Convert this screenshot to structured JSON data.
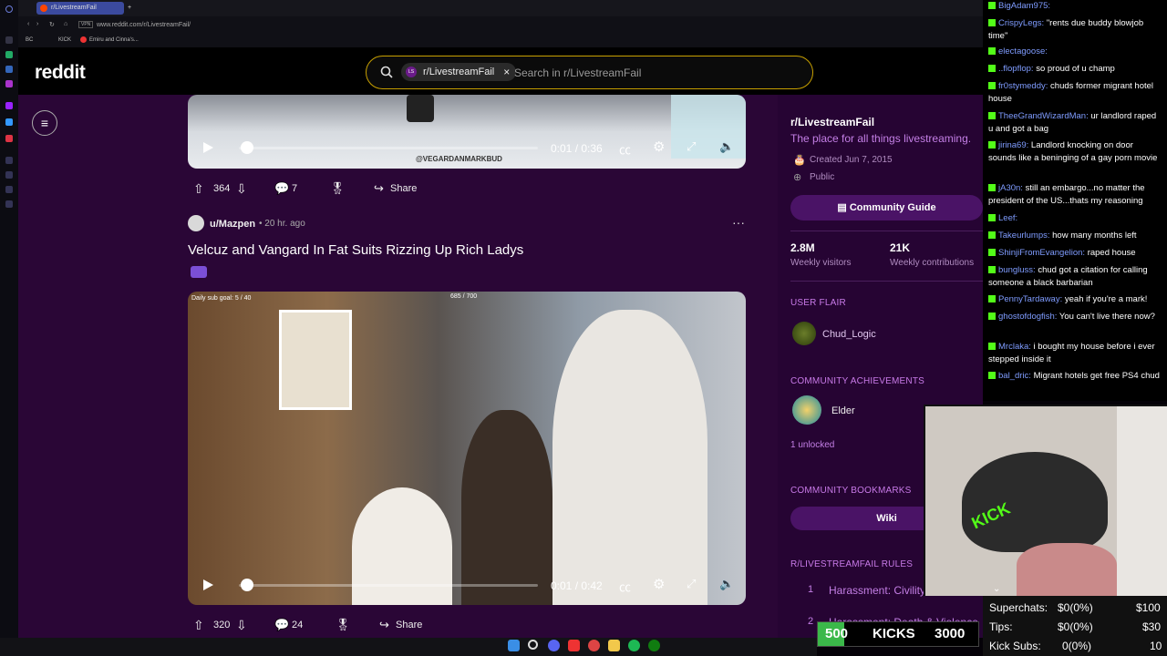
{
  "browser": {
    "tabs": [
      "r/LivestreamFail"
    ],
    "url": "www.reddit.com/r/LivestreamFail/",
    "vpn_label": "VPN",
    "bookmarks": [
      "BC",
      "KICK",
      "Emiru and Cinna's..."
    ]
  },
  "reddit": {
    "logo": "reddit",
    "search_chip": "r/LivestreamFail",
    "search_chip_badge": "LS",
    "search_placeholder": "Search in r/LivestreamFail"
  },
  "posts": [
    {
      "video_time": "0:01 / 0:36",
      "watermark": "@VEGARDANMARKBUD",
      "upvotes": "364",
      "comments": "7",
      "share": "Share"
    },
    {
      "author": "u/Mazpen",
      "age": "• 20 hr. ago",
      "title": "Velcuz and Vangard In Fat Suits Rizzing Up Rich Ladys",
      "overlay_goal": "Daily sub goal: 5 / 40",
      "overlay_top": "685 / 700",
      "video_time": "0:01 / 0:42",
      "upvotes": "320",
      "comments": "24",
      "share": "Share"
    }
  ],
  "sidebar": {
    "name": "r/LivestreamFail",
    "description": "The place for all things livestreaming.",
    "created": "Created Jun 7, 2015",
    "visibility": "Public",
    "guide_button": "Community Guide",
    "visitors_value": "2.8M",
    "visitors_label": "Weekly visitors",
    "contrib_value": "21K",
    "contrib_label": "Weekly contributions",
    "flair_head": "USER FLAIR",
    "flair_name": "Chud_Logic",
    "achievements_head": "COMMUNITY ACHIEVEMENTS",
    "achievement_name": "Elder",
    "unlocked": "1 unlocked",
    "bookmarks_head": "COMMUNITY BOOKMARKS",
    "wiki_button": "Wiki",
    "rules_head": "R/LIVESTREAMFAIL RULES",
    "rule1_num": "1",
    "rule1": "Harassment: Civility",
    "rule2_num": "2",
    "rule2": "Harassment: Death & Violence"
  },
  "chat": [
    {
      "user": "BigAdam975:",
      "msg": ""
    },
    {
      "user": "CrispyLegs:",
      "msg": "\"rents due buddy blowjob time\""
    },
    {
      "user": "electagoose:",
      "msg": ""
    },
    {
      "user": "..flopflop:",
      "msg": "so proud of u champ"
    },
    {
      "user": "fr0stymeddy:",
      "msg": "chuds former migrant hotel house"
    },
    {
      "user": "TheeGrandWizardMan:",
      "msg": "ur landlord raped u and got a bag"
    },
    {
      "user": "jirina69:",
      "msg": "Landlord knocking on door sounds like a beninging of a gay porn movie"
    },
    {
      "user": "jA30n:",
      "msg": "still an embargo...no matter the president of the US...thats my reasoning"
    },
    {
      "user": "Leef:",
      "msg": ""
    },
    {
      "user": "Takeurlumps:",
      "msg": "how many months left"
    },
    {
      "user": "ShinjiFromEvangelion:",
      "msg": "raped house"
    },
    {
      "user": "bungluss:",
      "msg": "chud got a citation for calling someone a black barbarian"
    },
    {
      "user": "PennyTardaway:",
      "msg": "yeah if you're a mark!"
    },
    {
      "user": "ghostofdogfish:",
      "msg": "You can't live there now?"
    },
    {
      "user": "Mrclaka:",
      "msg": "i bought my house before i ever stepped inside it"
    },
    {
      "user": "bal_dric:",
      "msg": "Migrant hotels get free PS4 chud"
    }
  ],
  "webcam": {
    "cap_text": "KICK"
  },
  "stats": {
    "superchats_label": "Superchats:",
    "superchats_value": "$0(0%)",
    "superchats_goal": "$100",
    "tips_label": "Tips:",
    "tips_value": "$0(0%)",
    "tips_goal": "$30",
    "kicksubs_label": "Kick Subs:",
    "kicksubs_value": "0(0%)",
    "kicksubs_goal": "10"
  },
  "kick_goal": {
    "current": "500",
    "label": "KICKS",
    "target": "3000",
    "progress": 0.1667
  }
}
